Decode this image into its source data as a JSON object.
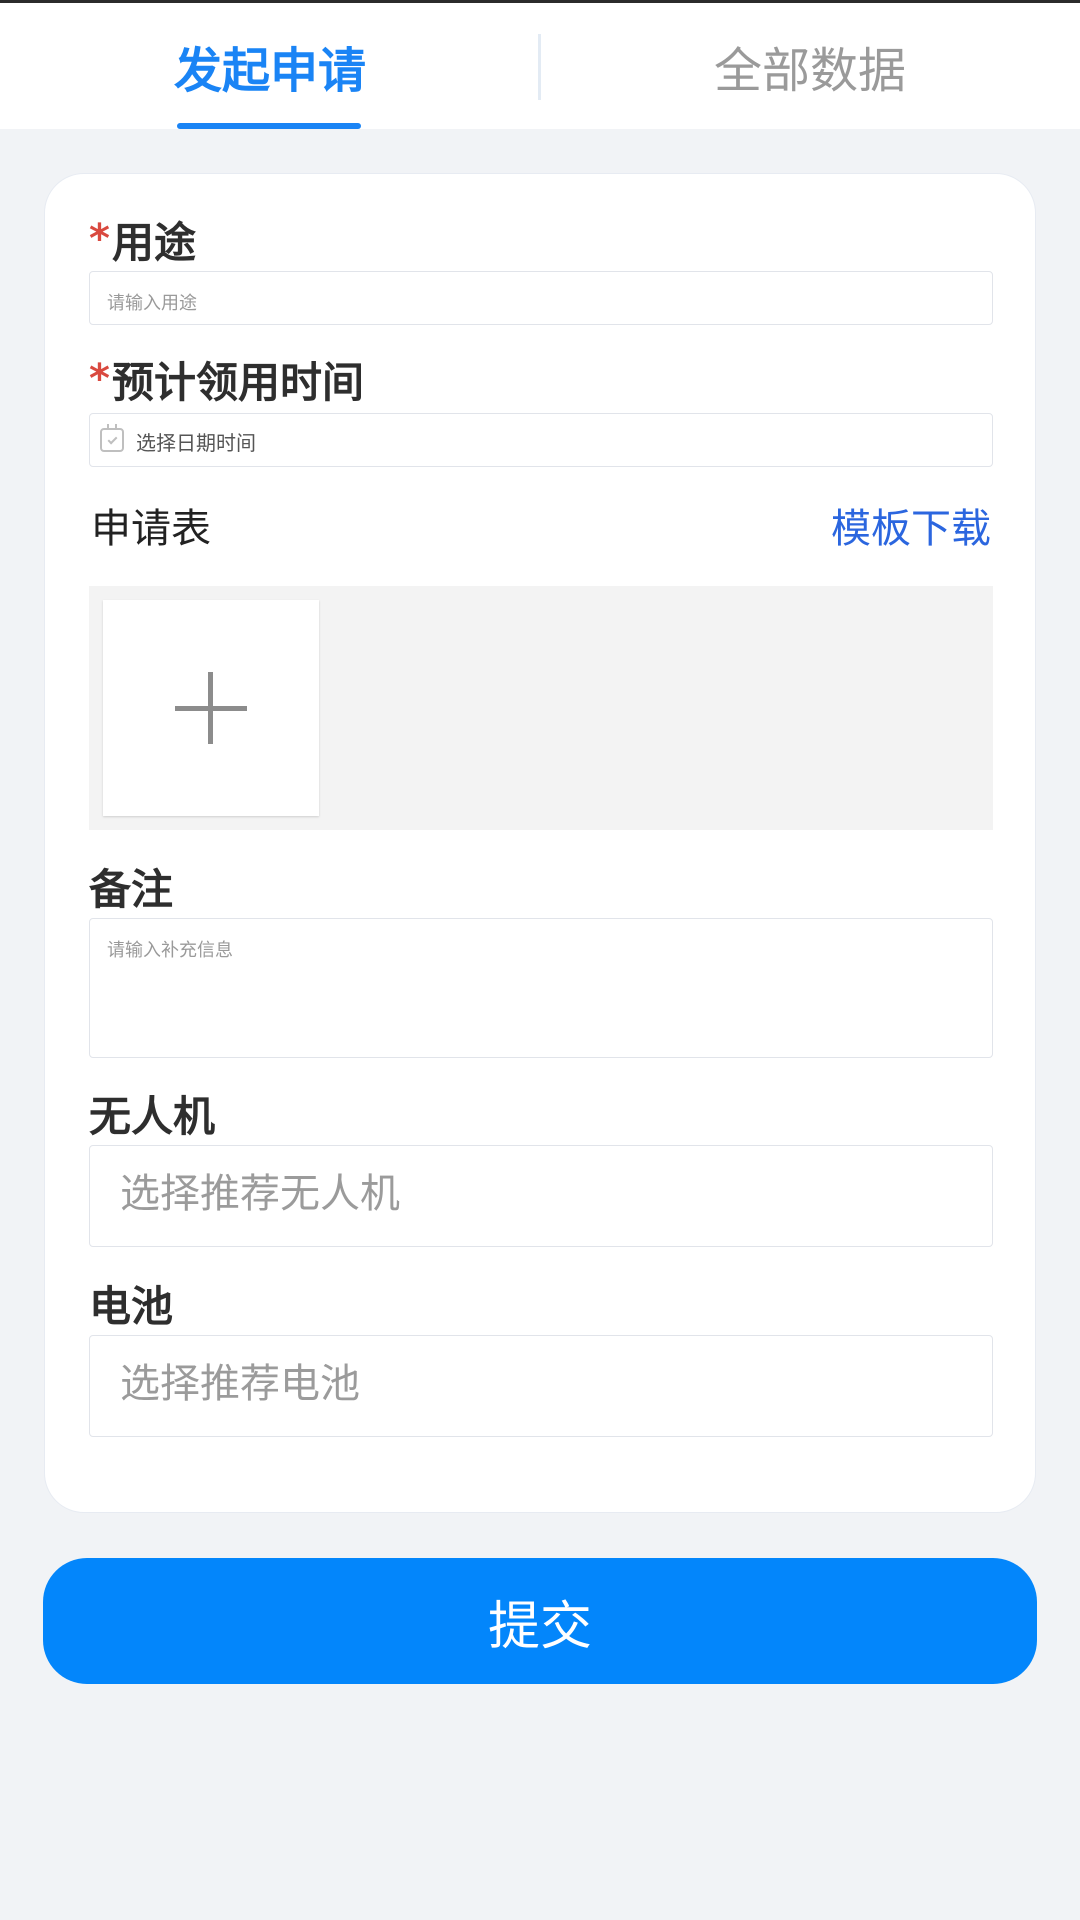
{
  "tabs": {
    "apply": "发起申请",
    "all_data": "全部数据"
  },
  "form": {
    "required_mark": "*",
    "purpose": {
      "label": "用途",
      "placeholder": "请输入用途"
    },
    "pickup_time": {
      "label": "预计领用时间",
      "placeholder": "选择日期时间"
    },
    "application_form": {
      "label": "申请表",
      "template_link": "模板下载"
    },
    "remark": {
      "label": "备注",
      "placeholder": "请输入补充信息"
    },
    "drone": {
      "label": "无人机",
      "placeholder": "选择推荐无人机"
    },
    "battery": {
      "label": "电池",
      "placeholder": "选择推荐电池"
    }
  },
  "submit_label": "提交",
  "colors": {
    "accent": "#1a84f5",
    "button": "#0386fb",
    "required": "#d9493f",
    "link": "#2b66df"
  }
}
